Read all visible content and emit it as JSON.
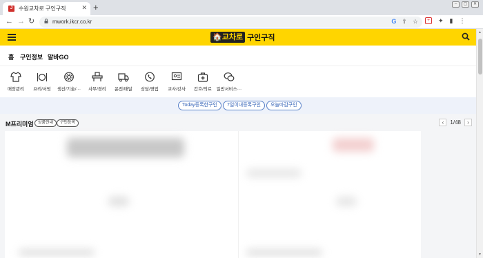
{
  "browser": {
    "tab_title": "수원교차로 구인구직",
    "favicon_text": "J",
    "close_glyph": "✕",
    "newtab_glyph": "+",
    "url": "mwork.ikcr.co.kr",
    "window_buttons": [
      "–",
      "▢",
      "✕"
    ],
    "nav_icons": [
      "arrow-left-icon",
      "arrow-right-icon",
      "reload-icon"
    ],
    "omnibox_icons": [
      "google-icon",
      "share-icon",
      "star-icon"
    ],
    "extension_icons": [
      "extension-red-icon",
      "puzzle-icon",
      "sidepanel-icon",
      "more-icon"
    ]
  },
  "header": {
    "logo_box": "🏠교차로",
    "logo_text": "구인구직",
    "background": "#ffd500"
  },
  "nav": {
    "tabs": [
      "홈",
      "구인정보",
      "알바GO"
    ]
  },
  "categories": [
    {
      "label": "매장관리",
      "icon": "shirt-icon"
    },
    {
      "label": "요리/서빙",
      "icon": "dining-icon"
    },
    {
      "label": "생산/기술/···",
      "icon": "gear-icon"
    },
    {
      "label": "사무/경리",
      "icon": "office-icon"
    },
    {
      "label": "운전/배달",
      "icon": "truck-icon"
    },
    {
      "label": "상담/영업",
      "icon": "phone-icon"
    },
    {
      "label": "교사/강사",
      "icon": "board-icon"
    },
    {
      "label": "간호/의료",
      "icon": "medkit-icon"
    },
    {
      "label": "일반서비스···",
      "icon": "chat-icon"
    }
  ],
  "filters": [
    "Today등록한구인",
    "7일이내등록구인",
    "오늘마감구인"
  ],
  "premium": {
    "title": "M프리미엄",
    "chips": [
      "상품안내",
      "구인등록"
    ],
    "page": "1/48",
    "prev": "‹",
    "next": "›"
  },
  "colors": {
    "accent_yellow": "#ffd500",
    "pill_blue": "#2f5fb5"
  }
}
